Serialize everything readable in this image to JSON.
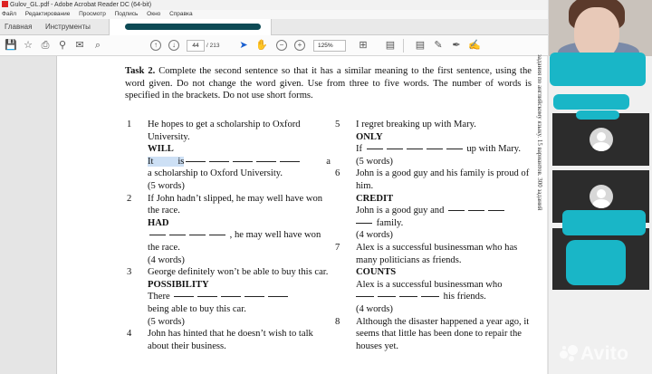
{
  "window": {
    "title": "Gulov_GL.pdf - Adobe Acrobat Reader DC (64-bit)"
  },
  "menu": [
    "Файл",
    "Редактирование",
    "Просмотр",
    "Подпись",
    "Окно",
    "Справка"
  ],
  "tabs": {
    "home": "Главная",
    "tools": "Инструменты"
  },
  "toolbar": {
    "page_current": "44",
    "page_total": "/ 213",
    "zoom": "125%"
  },
  "side_text": "задания по английскому языку. 15 вариантов. 300 заданий",
  "task": {
    "label": "Task 2.",
    "text": "Complete the second sentence so that it has a similar meaning to the first sentence, using the word given. Do not change the word given. Use from three to five words. The number of words is specified in the brackets. Do not use short forms."
  },
  "items": [
    {
      "num": "1",
      "s1": "He hopes to get a scholarship to Oxford University.",
      "kw": "WILL",
      "pre": "It is",
      "post": "a scholarship to Oxford University.",
      "words": "(5 words)"
    },
    {
      "num": "2",
      "s1": "If John hadn’t slipped, he may well have won the race.",
      "kw": "HAD",
      "post": ", he may well have won the race.",
      "words": "(4 words)"
    },
    {
      "num": "3",
      "s1": "George definitely won’t be able to buy this car.",
      "kw": "POSSIBILITY",
      "pre": "There",
      "post": "being able to buy this car.",
      "words": "(5 words)"
    },
    {
      "num": "4",
      "s1": "John has hinted that he doesn’t wish to talk about their business."
    },
    {
      "num": "5",
      "s1": "I regret breaking up with Mary.",
      "kw": "ONLY",
      "pre": "If",
      "post": "up with Mary.",
      "words": "(5 words)"
    },
    {
      "num": "6",
      "s1": "John is a good guy and his family is proud of him.",
      "kw": "CREDIT",
      "pre": "John is a good guy and",
      "post": "family.",
      "words": "(4 words)"
    },
    {
      "num": "7",
      "s1": "Alex is a successful businessman who has many politicians as friends.",
      "kw": "COUNTS",
      "pre": "Alex is a successful businessman who",
      "post": "his friends.",
      "words": "(4 words)"
    },
    {
      "num": "8",
      "s1": "Although the disaster happened a year ago, it seems that little has been done to repair the houses yet."
    }
  ],
  "watermark": "Avito"
}
